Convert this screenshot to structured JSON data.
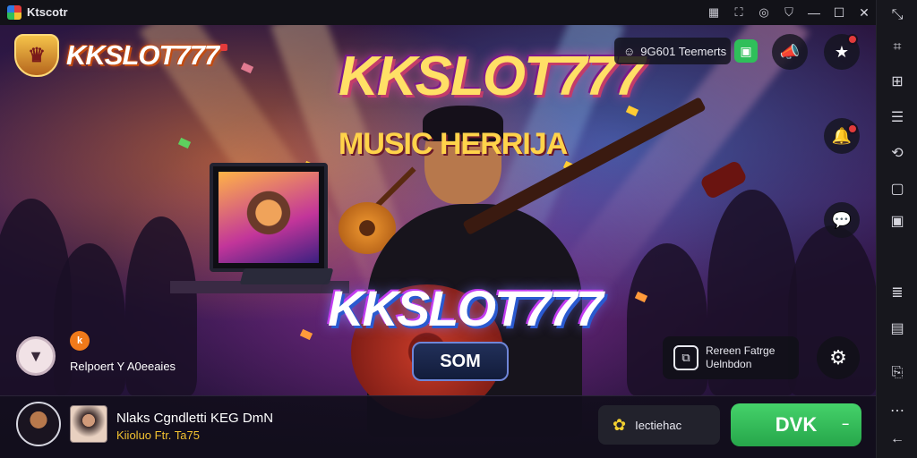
{
  "window": {
    "title": "Ktscotr",
    "title_icons": [
      "window-grid-icon",
      "fullscreen-icon",
      "settings-dial-icon",
      "shield-icon"
    ],
    "controls": [
      "minimize",
      "maximize",
      "close"
    ]
  },
  "logo": {
    "text": "KKSLOT777"
  },
  "headline": {
    "title": "KKSLOT777",
    "subtitle": "MUSIC HERRIJA"
  },
  "hero": {
    "logo_text": "KKSLOT777",
    "button_label": "SOM"
  },
  "top_controls": {
    "online_label": "9G601 Teemerts"
  },
  "left_controls": {
    "report_label": "Relpoert Y A0eeaies",
    "badge_text": "k"
  },
  "side_card": {
    "line1": "Rereen Fatrge",
    "line2": "Uelnbdon"
  },
  "bottom_bar": {
    "track_title": "Nlaks Cgndletti KEG DmN",
    "track_sub": "Kiioluo Ftr. Ta75",
    "pick_label": "Iectiehac",
    "ok_label": "DVK",
    "ok_suffix": "–"
  },
  "colors": {
    "accent_green": "#2fbf5a",
    "accent_gold": "#ffe066",
    "badge_red": "#e23b3b",
    "badge_orange": "#f07a1a"
  }
}
